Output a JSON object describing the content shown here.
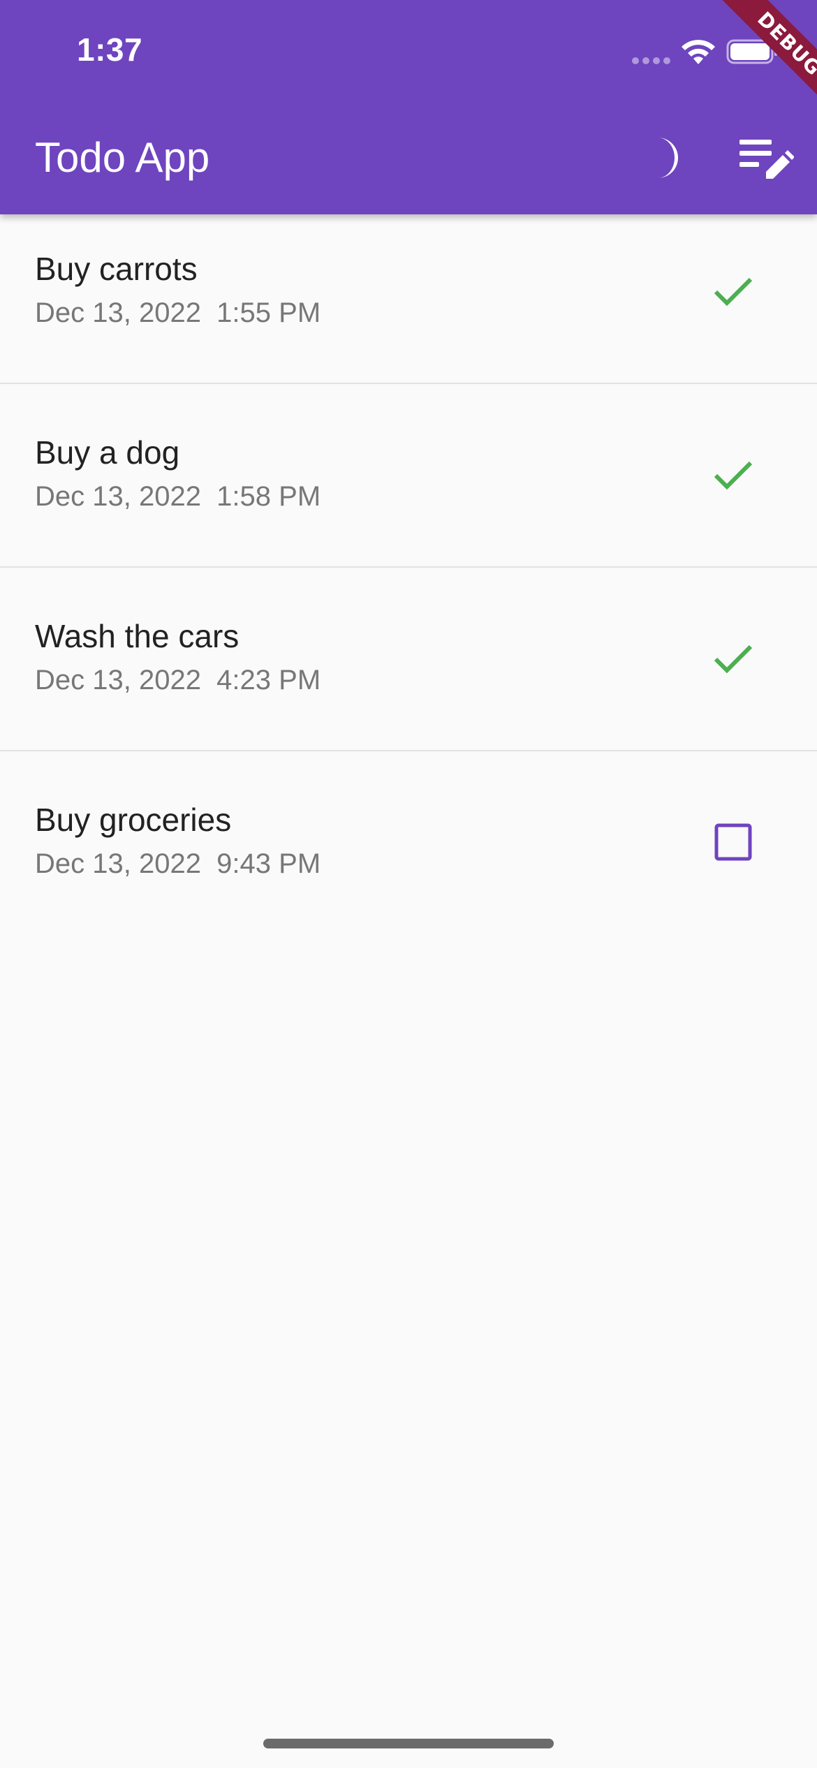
{
  "status_bar": {
    "time": "1:37",
    "signal_icon": "cellular-signal-dots-icon",
    "wifi_icon": "wifi-icon",
    "battery_icon": "battery-icon"
  },
  "debug_banner": {
    "label": "DEBUG",
    "color": "#8b1a3c"
  },
  "app_bar": {
    "title": "Todo App",
    "background_color": "#6f44bf",
    "actions": [
      {
        "icon": "moon-icon",
        "purpose": "theme-toggle"
      },
      {
        "icon": "edit-list-icon",
        "purpose": "edit-list"
      }
    ]
  },
  "todos": [
    {
      "title": "Buy carrots",
      "date": "Dec 13, 2022  1:55 PM",
      "completed": true
    },
    {
      "title": "Buy a dog",
      "date": "Dec 13, 2022  1:58 PM",
      "completed": true
    },
    {
      "title": "Wash the cars",
      "date": "Dec 13, 2022  4:23 PM",
      "completed": true
    },
    {
      "title": "Buy groceries",
      "date": "Dec 13, 2022  9:43 PM",
      "completed": false
    }
  ],
  "colors": {
    "check": "#4caf50",
    "checkbox_border": "#6f44bf",
    "title_text": "#222222",
    "date_text": "#777777"
  }
}
